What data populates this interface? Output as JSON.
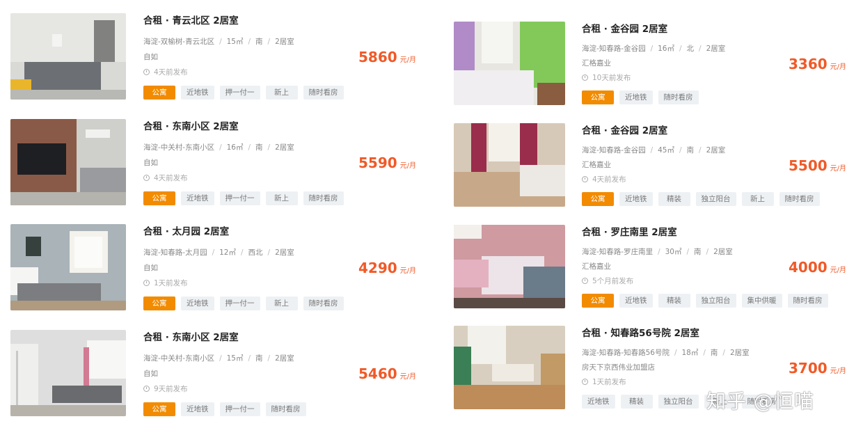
{
  "left": [
    {
      "title": "合租 · 青云北区 2居室",
      "district": "海淀-双榆树-青云北区",
      "area": "15㎡",
      "facing": "南",
      "rooms": "2居室",
      "agent": "自如",
      "posted": "4天前发布",
      "tags": [
        "公寓",
        "近地铁",
        "押一付一",
        "新上",
        "随时看房"
      ],
      "price": "5860",
      "unit": "元/月"
    },
    {
      "title": "合租 · 东南小区 2居室",
      "district": "海淀-中关村-东南小区",
      "area": "16㎡",
      "facing": "南",
      "rooms": "2居室",
      "agent": "自如",
      "posted": "4天前发布",
      "tags": [
        "公寓",
        "近地铁",
        "押一付一",
        "新上",
        "随时看房"
      ],
      "price": "5590",
      "unit": "元/月"
    },
    {
      "title": "合租 · 太月园 2居室",
      "district": "海淀-知春路-太月园",
      "area": "12㎡",
      "facing": "西北",
      "rooms": "2居室",
      "agent": "自如",
      "posted": "1天前发布",
      "tags": [
        "公寓",
        "近地铁",
        "押一付一",
        "新上",
        "随时看房"
      ],
      "price": "4290",
      "unit": "元/月"
    },
    {
      "title": "合租 · 东南小区 2居室",
      "district": "海淀-中关村-东南小区",
      "area": "15㎡",
      "facing": "南",
      "rooms": "2居室",
      "agent": "自如",
      "posted": "9天前发布",
      "tags": [
        "公寓",
        "近地铁",
        "押一付一",
        "随时看房"
      ],
      "price": "5460",
      "unit": "元/月"
    }
  ],
  "right": [
    {
      "title": "合租 · 金谷园 2居室",
      "district": "海淀-知春路-金谷园",
      "area": "16㎡",
      "facing": "北",
      "rooms": "2居室",
      "agent": "汇格嘉业",
      "posted": "10天前发布",
      "tags": [
        "公寓",
        "近地铁",
        "随时看房"
      ],
      "price": "3360",
      "unit": "元/月"
    },
    {
      "title": "合租 · 金谷园 2居室",
      "district": "海淀-知春路-金谷园",
      "area": "45㎡",
      "facing": "南",
      "rooms": "2居室",
      "agent": "汇格嘉业",
      "posted": "4天前发布",
      "tags": [
        "公寓",
        "近地铁",
        "精装",
        "独立阳台",
        "新上",
        "随时看房"
      ],
      "price": "5500",
      "unit": "元/月"
    },
    {
      "title": "合租 · 罗庄南里 2居室",
      "district": "海淀-知春路-罗庄南里",
      "area": "30㎡",
      "facing": "南",
      "rooms": "2居室",
      "agent": "汇格嘉业",
      "posted": "5个月前发布",
      "tags": [
        "公寓",
        "近地铁",
        "精装",
        "独立阳台",
        "集中供暖",
        "随时看房"
      ],
      "price": "4000",
      "unit": "元/月"
    },
    {
      "title": "合租 · 知春路56号院 2居室",
      "district": "海淀-知春路-知春路56号院",
      "area": "18㎡",
      "facing": "南",
      "rooms": "2居室",
      "agent": "房天下京西伟业加盟店",
      "posted": "1天前发布",
      "tags": [
        "近地铁",
        "精装",
        "独立阳台",
        "新上",
        "随时看房"
      ],
      "price": "3700",
      "unit": "元/月"
    }
  ],
  "watermark": "知乎 @恒喵",
  "colors": {
    "price": "#f05a28",
    "primary_tag": "#f28b00",
    "tag_bg": "#eef1f4"
  }
}
